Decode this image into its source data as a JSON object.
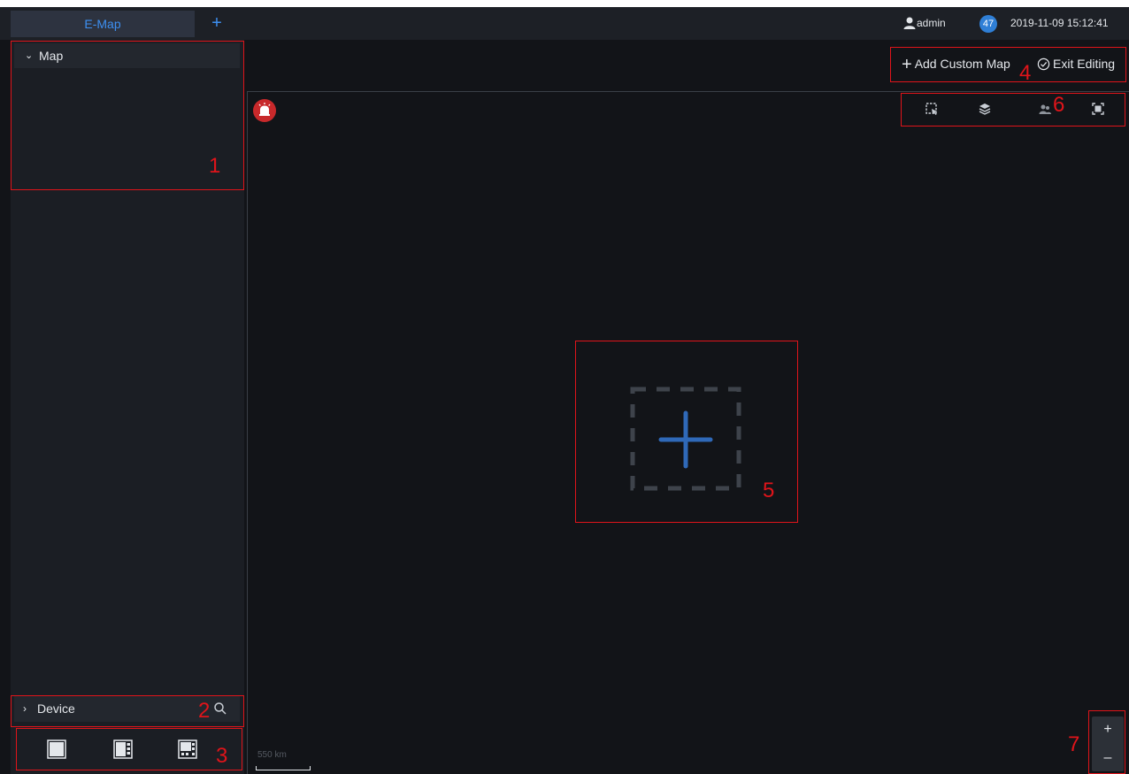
{
  "tabs": {
    "active_label": "E-Map",
    "add_label": "+"
  },
  "status": {
    "user": "admin",
    "alarm_count": "47",
    "datetime": "2019-11-09 15:12:41"
  },
  "sidebar": {
    "map_section_label": "Map",
    "device_section_label": "Device"
  },
  "map_toolbar": {
    "add_custom_map_label": "Add Custom Map",
    "exit_editing_label": "Exit Editing"
  },
  "zoom": {
    "in_label": "+",
    "out_label": "–"
  },
  "scale": {
    "label": "550 km"
  },
  "callouts": [
    "1",
    "2",
    "3",
    "4",
    "5",
    "6",
    "7"
  ],
  "colors": {
    "accent_blue": "#3d8ff0",
    "alarm_red": "#c8292b",
    "callout_red": "#e0141a",
    "background": "#121418"
  },
  "icons": {
    "user": "user-icon",
    "search": "search-icon",
    "alarm": "alarm-icon",
    "select": "select-area-icon",
    "layers": "layers-icon",
    "people": "people-icon",
    "fullscreen": "fullscreen-icon"
  }
}
